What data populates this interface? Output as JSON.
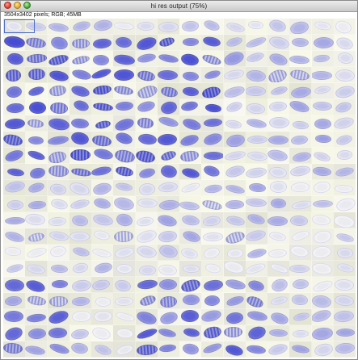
{
  "window": {
    "title": "hi res output (75%)",
    "info": "3504x3402 pixels; RGB; 45MB"
  },
  "mosaic": {
    "columns": 16,
    "rows": 21,
    "stain_color": "#3a3fc0",
    "background_color": "#eeeee6"
  },
  "icons": {
    "close": "close-button-icon",
    "minimize": "minimize-button-icon",
    "zoom": "zoom-button-icon"
  }
}
